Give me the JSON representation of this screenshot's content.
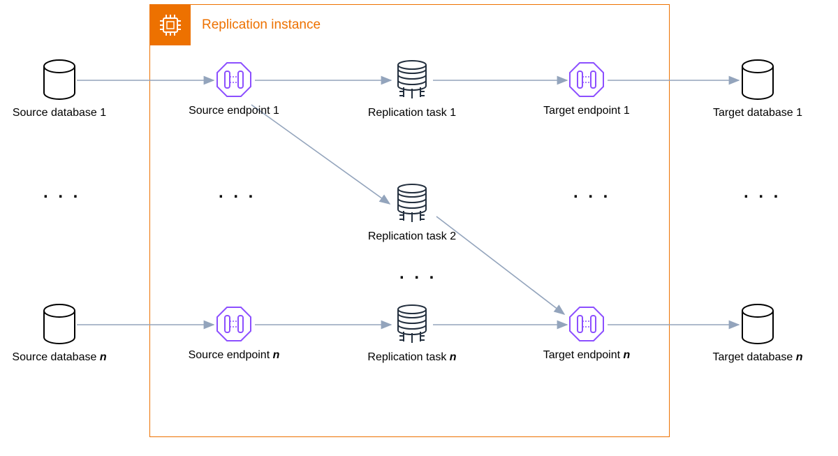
{
  "container": {
    "title": "Replication instance"
  },
  "labels": {
    "srcDb1": "Source database 1",
    "srcDbN_pre": "Source database ",
    "srcDbN_n": "n",
    "srcEp1": "Source endpoint 1",
    "srcEpN_pre": "Source endpoint ",
    "srcEpN_n": "n",
    "task1": "Replication task 1",
    "task2": "Replication task 2",
    "taskN_pre": "Replication task ",
    "taskN_n": "n",
    "tgtEp1": "Target endpoint 1",
    "tgtEpN_pre": "Target endpoint ",
    "tgtEpN_n": "n",
    "tgtDb1": "Target database 1",
    "tgtDbN_pre": "Target database ",
    "tgtDbN_n": "n"
  },
  "ellipsis": ". . .",
  "colors": {
    "orange": "#ED7100",
    "arrow": "#93A4BC",
    "purple": "#8C4FFF",
    "navy": "#232F3E"
  }
}
